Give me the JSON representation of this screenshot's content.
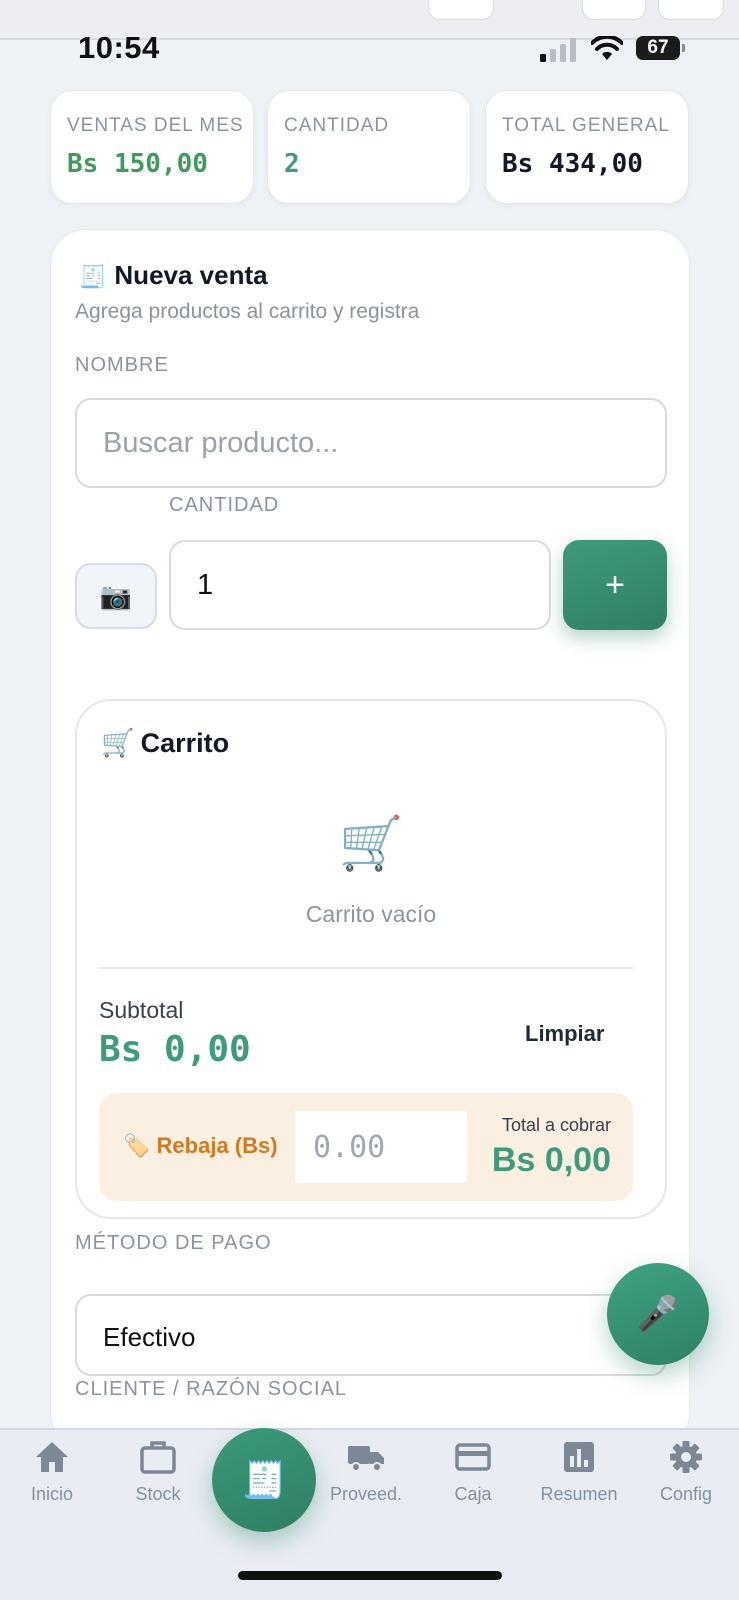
{
  "status_bar": {
    "time": "10:54",
    "battery": "67"
  },
  "stats": [
    {
      "label": "VENTAS DEL MES",
      "value": "Bs 150,00",
      "color": "#3f9b5c"
    },
    {
      "label": "CANTIDAD",
      "value": "2",
      "color": "#3f9b7c"
    },
    {
      "label": "TOTAL GENERAL",
      "value": "Bs 434,00",
      "color": "#111827"
    }
  ],
  "new_sale": {
    "icon": "receipt-icon",
    "title": "Nueva venta",
    "subtitle": "Agrega productos al carrito y registra",
    "name_label": "NOMBRE",
    "search_placeholder": "Buscar producto...",
    "qty_label": "CANTIDAD",
    "qty_value": "1",
    "add_label": "+"
  },
  "cart": {
    "icon": "cart-icon",
    "title": "Carrito",
    "empty_text": "Carrito vacío",
    "subtotal_label": "Subtotal",
    "subtotal_value": "Bs 0,00",
    "clear_label": "Limpiar",
    "discount_label": "Rebaja (Bs)",
    "discount_placeholder": "0.00",
    "total_label": "Total a cobrar",
    "total_value": "Bs 0,00"
  },
  "payment": {
    "label": "MÉTODO DE PAGO",
    "value": "Efectivo"
  },
  "client": {
    "label": "CLIENTE / RAZÓN SOCIAL"
  },
  "nav": [
    {
      "label": "Inicio",
      "icon": "home-icon"
    },
    {
      "label": "Stock",
      "icon": "box-icon"
    },
    {
      "label": "Proveed.",
      "icon": "truck-icon"
    },
    {
      "label": "Caja",
      "icon": "card-icon"
    },
    {
      "label": "Resumen",
      "icon": "chart-icon"
    },
    {
      "label": "Config",
      "icon": "gear-icon"
    }
  ],
  "colors": {
    "accent": "#3f9b7c",
    "discount_bg": "#fbefe2",
    "discount_text": "#d27a1e"
  }
}
